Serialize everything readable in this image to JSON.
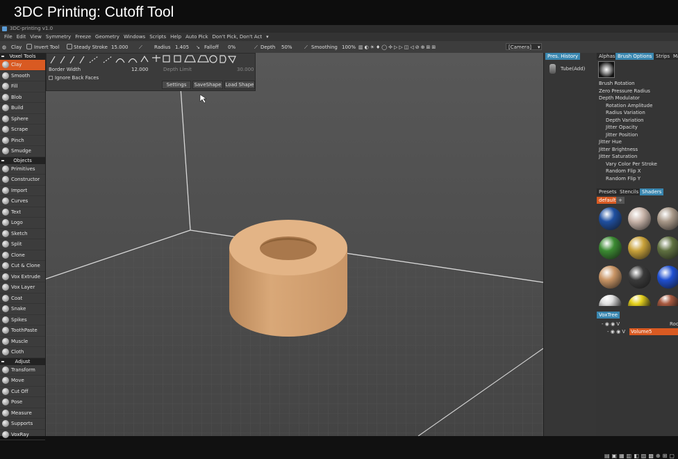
{
  "video_title": "3DC Printing: Cutoff Tool",
  "window_title": "3DC-printing v1.0",
  "menu": [
    "File",
    "Edit",
    "View",
    "Symmetry",
    "Freeze",
    "Geometry",
    "Windows",
    "Scripts",
    "Help",
    "Auto Pick",
    "Don't Pick, Don't Act"
  ],
  "toolbar": {
    "tool": "Clay",
    "invert": "Invert Tool",
    "steady": "Steady Stroke",
    "steady_value": "15.000",
    "radius": "Radius",
    "radius_value": "1.405",
    "falloff": "Falloff",
    "falloff_value": "0%",
    "depth": "Depth",
    "depth_value": "50%",
    "smoothing": "Smoothing",
    "smoothing_value": "100%",
    "camera": "[Camera]"
  },
  "sub_toolbar": {
    "border_width_label": "Border Width",
    "border_width_value": "12.000",
    "depth_limit_label": "Depth Limit",
    "depth_limit_value": "30.000",
    "ignore_back_faces": "Ignore Back Faces",
    "settings": "Settings",
    "save_shape": "SaveShape",
    "load_shape": "Load Shape"
  },
  "left_panel": {
    "voxel_tools_header": "Voxel Tools",
    "voxel_tools": [
      "Clay",
      "Smooth",
      "Fill",
      "Blob",
      "Build",
      "Sphere",
      "Scrape",
      "Pinch",
      "Smudge"
    ],
    "objects_header": "Objects",
    "objects": [
      "Primitives",
      "Constructor",
      "Import",
      "Curves",
      "Text",
      "Logo",
      "Sketch",
      "Split",
      "Clone",
      "Cut & Clone",
      "Vox Extrude",
      "Vox Layer",
      "Coat",
      "Snake",
      "Spikes",
      "ToothPaste",
      "Muscle",
      "Cloth"
    ],
    "adjust_header": "Adjust",
    "adjust": [
      "Transform",
      "Move",
      "Cut Off",
      "Pose",
      "Measure",
      "Supports",
      "VoxRay"
    ]
  },
  "pres_history": {
    "tab": "Pres. History",
    "item": "Tube(Add)"
  },
  "right_tabs": [
    "Alphas",
    "Brush Options",
    "Strips",
    "Ma"
  ],
  "brush_options": [
    "Brush Rotation",
    "Zero Pressure Radius",
    "Depth Modulator",
    "Rotation Amplitude",
    "Radius Variation",
    "Depth Variation",
    "Jitter Opacity",
    "Jitter Position",
    "Jitter Hue",
    "Jitter Brightness",
    "Jitter Saturation",
    "Vary Color Per Stroke",
    "Random Flip X",
    "Random Flip Y"
  ],
  "shader_tabs": [
    "Presets",
    "Stencils",
    "Shaders"
  ],
  "shader_category": "default",
  "shader_colors": [
    "#1f4fa0",
    "#c9b5aa",
    "#a89888",
    "#3b8a32",
    "#c9a23a",
    "#5f7040",
    "#c99565",
    "#3a3a3a",
    "#1f4fd0",
    "#e0e0e0",
    "#e6d21f",
    "#a85a40"
  ],
  "voxtree": {
    "tab": "VoxTree",
    "root": "V",
    "root_suffix": "Roo",
    "child": "V",
    "volume": "Volume5"
  },
  "colors": {
    "accent": "#d95a22",
    "tab_active": "#3a87b0",
    "object": "#d4a070"
  }
}
